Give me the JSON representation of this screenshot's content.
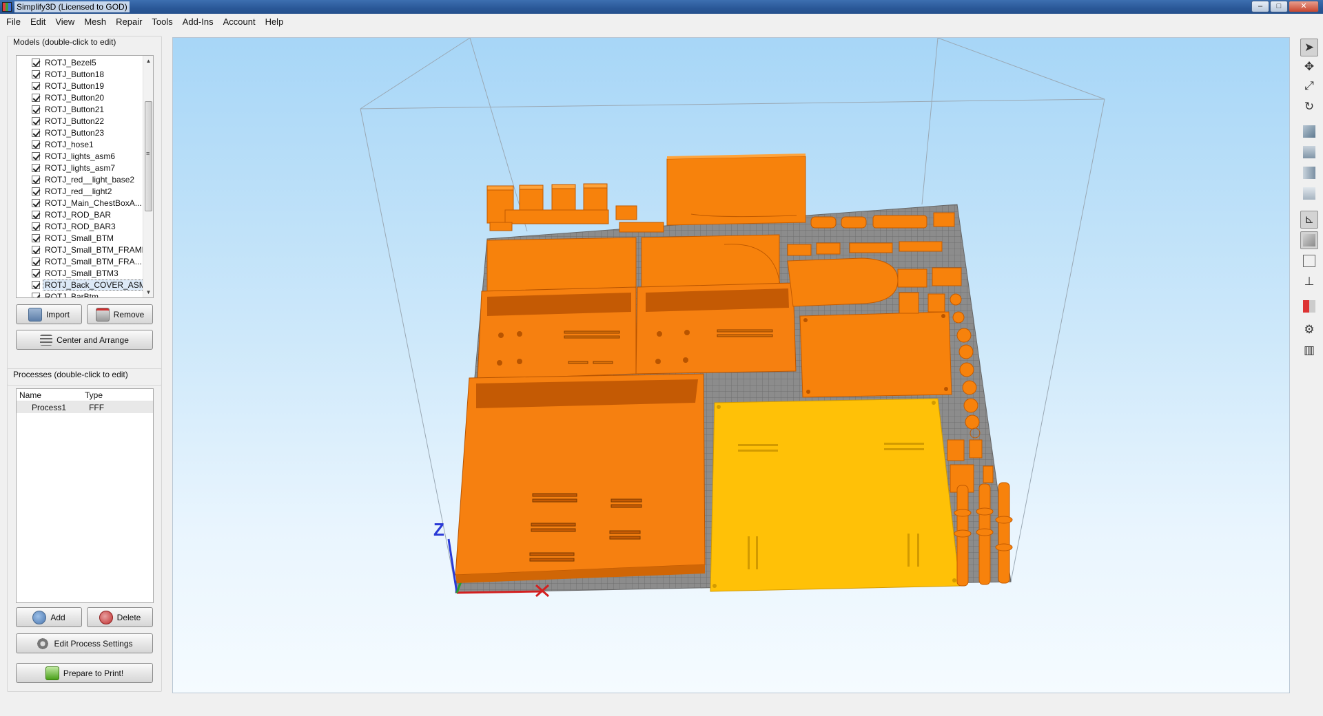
{
  "window": {
    "title": "Simplify3D (Licensed to GOD)"
  },
  "menu": [
    "File",
    "Edit",
    "View",
    "Mesh",
    "Repair",
    "Tools",
    "Add-Ins",
    "Account",
    "Help"
  ],
  "models_panel": {
    "title": "Models (double-click to edit)",
    "items": [
      "ROTJ_Bezel5",
      "ROTJ_Button18",
      "ROTJ_Button19",
      "ROTJ_Button20",
      "ROTJ_Button21",
      "ROTJ_Button22",
      "ROTJ_Button23",
      "ROTJ_hose1",
      "ROTJ_lights_asm6",
      "ROTJ_lights_asm7",
      "ROTJ_red__light_base2",
      "ROTJ_red__light2",
      "ROTJ_Main_ChestBoxA...",
      "ROTJ_ROD_BAR",
      "ROTJ_ROD_BAR3",
      "ROTJ_Small_BTM",
      "ROTJ_Small_BTM_FRAME",
      "ROTJ_Small_BTM_FRA...",
      "ROTJ_Small_BTM3",
      "ROTJ_Back_COVER_ASM",
      "ROTJ_BarBtm"
    ],
    "selected_index": 19,
    "import_label": "Import",
    "remove_label": "Remove",
    "center_arrange_label": "Center and Arrange"
  },
  "processes_panel": {
    "title": "Processes (double-click to edit)",
    "columns": [
      "Name",
      "Type"
    ],
    "rows": [
      {
        "name": "Process1",
        "type": "FFF"
      }
    ],
    "add_label": "Add",
    "delete_label": "Delete",
    "edit_label": "Edit Process Settings",
    "prepare_label": "Prepare to Print!"
  },
  "viewport": {
    "axis_label": "Z"
  },
  "toolbar": {
    "tools": [
      "select-icon",
      "move-icon",
      "scale-icon",
      "rotate-icon",
      "view-default-icon",
      "view-front-icon",
      "view-side-icon",
      "view-top-icon",
      "axes-icon",
      "solid-view-icon",
      "wireframe-view-icon",
      "normals-icon",
      "cross-section-icon",
      "settings-icon",
      "supports-icon"
    ]
  },
  "colors": {
    "part_orange": "#f7820c",
    "part_selected": "#ffc107",
    "bed_gray": "#8a8a8a"
  }
}
